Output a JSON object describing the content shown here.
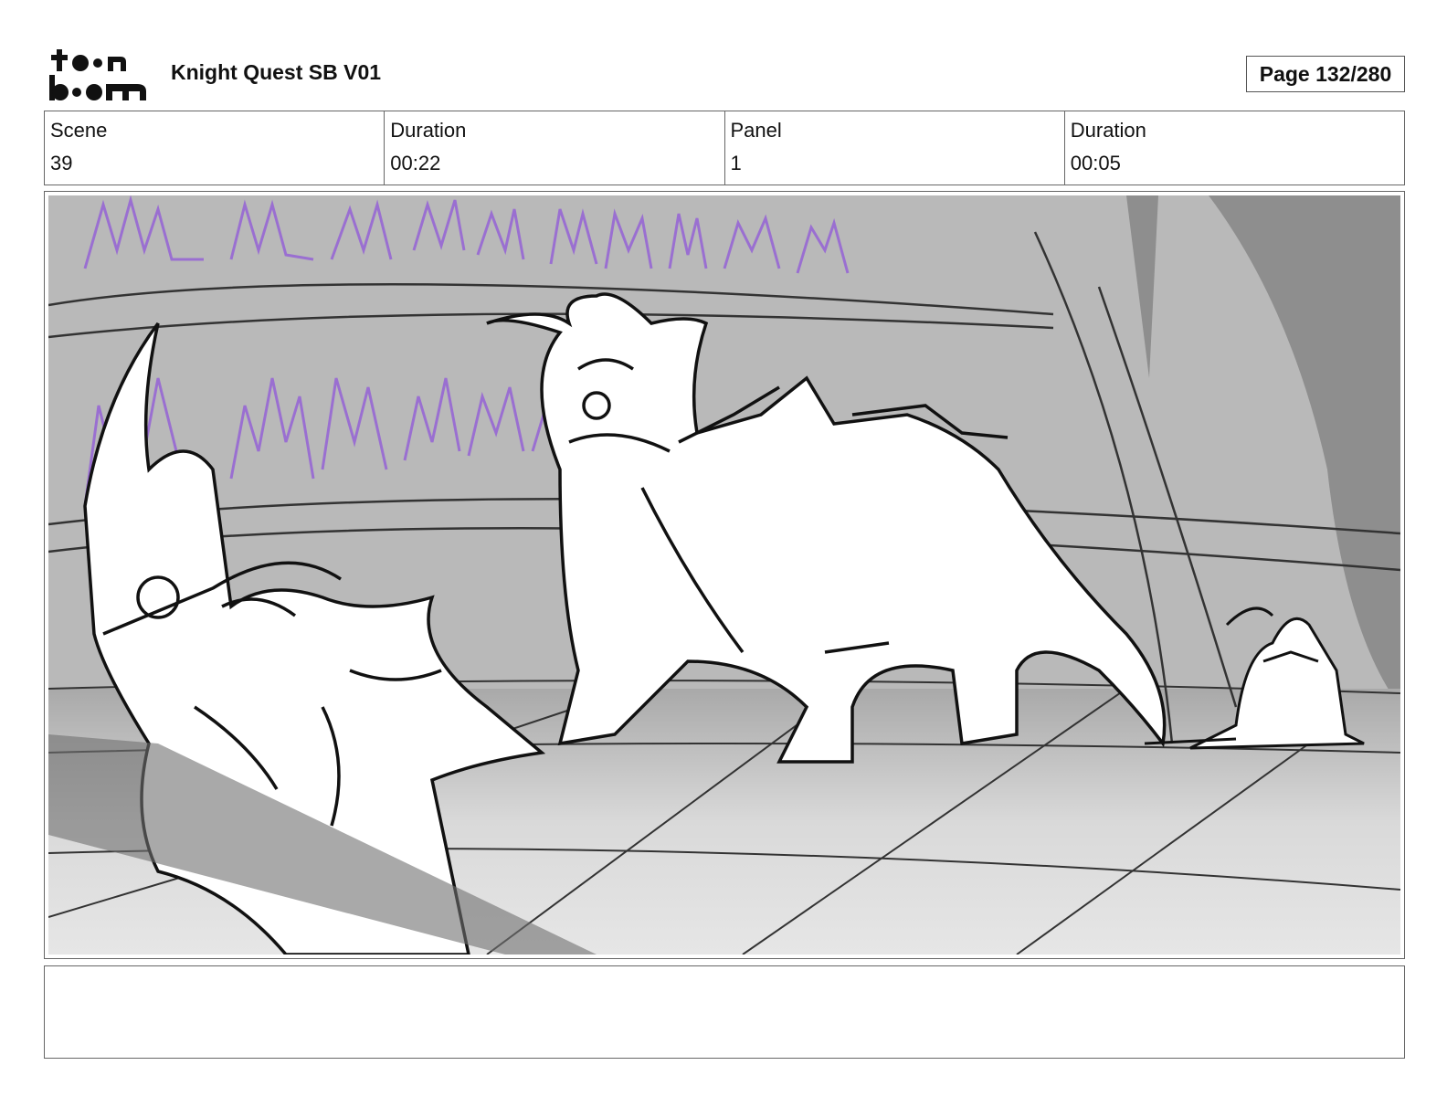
{
  "header": {
    "logo_text": "toon boom",
    "title": "Knight Quest SB V01",
    "page": "Page 132/280"
  },
  "info": {
    "scene_label": "Scene",
    "scene_value": "39",
    "scene_duration_label": "Duration",
    "scene_duration_value": "00:22",
    "panel_label": "Panel",
    "panel_value": "1",
    "panel_duration_label": "Duration",
    "panel_duration_value": "00:05"
  },
  "notes": {
    "text": ""
  },
  "colors": {
    "sketch_purple": "#9a6fd1",
    "background_gray": "#b8b8b8",
    "line_black": "#111111"
  }
}
